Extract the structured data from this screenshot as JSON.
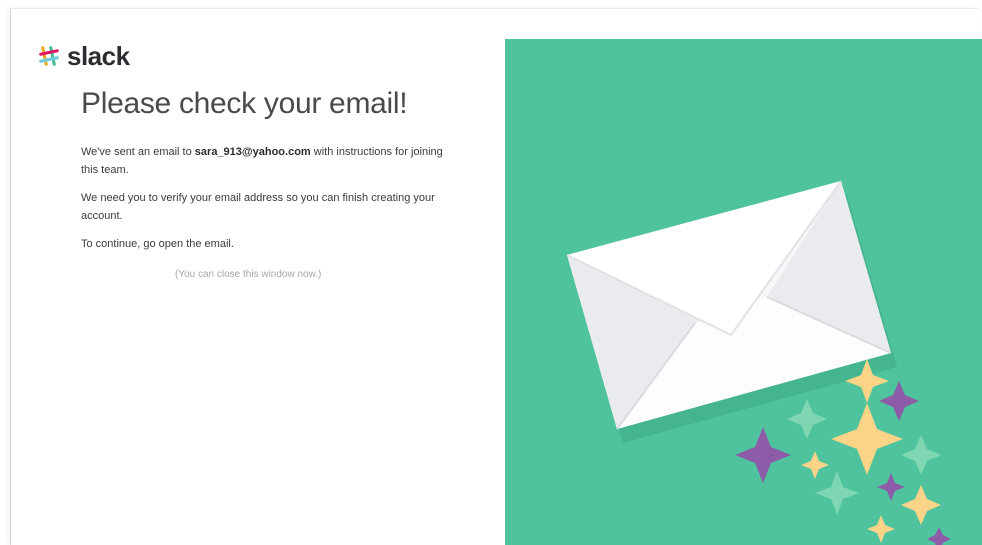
{
  "brand": {
    "name": "slack",
    "logo_icon": "slack-hash-icon",
    "colors": [
      "#e9a820",
      "#3eb991",
      "#e01563",
      "#6ecadc"
    ]
  },
  "content": {
    "headline": "Please check your email!",
    "p1_before": "We've sent an email to ",
    "p1_email": "sara_913@yahoo.com",
    "p1_after": " with instructions for joining this team.",
    "p2": "We need you to verify your email address so you can finish creating your account.",
    "p3": "To continue, go open the email.",
    "note": "(You can close this window now.)"
  },
  "illustration": {
    "icon": "envelope-icon",
    "sparkle_icon": "sparkle-icon",
    "background_color": "#4fc39d",
    "envelope_color": "#ffffff",
    "sparkle_colors": [
      "#fbd487",
      "#8d5ca9",
      "#7fd6b3"
    ]
  }
}
